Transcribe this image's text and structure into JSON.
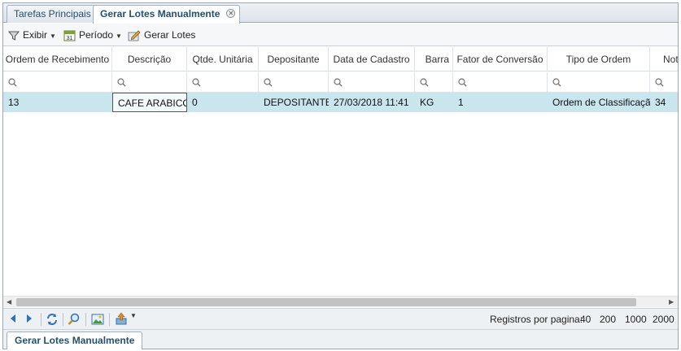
{
  "tabs": [
    {
      "label": "Tarefas Principais"
    },
    {
      "label": "Gerar Lotes Manualmente"
    }
  ],
  "toolbar": {
    "exibir_label": "Exibir",
    "periodo_label": "Período",
    "periodo_icon_day": "31",
    "gerar_label": "Gerar Lotes"
  },
  "grid": {
    "columns": [
      "Ordem de Recebimento",
      "Descrição",
      "Qtde. Unitária",
      "Depositante",
      "Data de Cadastro",
      "Barra",
      "Fator de Conversão",
      "Tipo de Ordem",
      "Nota"
    ],
    "rows": [
      [
        "13",
        "CAFE ARABICO",
        "0",
        "DEPOSITANTE",
        "27/03/2018 11:41",
        "KG",
        "1",
        "Ordem de Classificação",
        "34"
      ]
    ],
    "selected_row_color": "#c9e6ee"
  },
  "pager": {
    "label": "Registros por pagina:",
    "options": [
      "40",
      "200",
      "1000",
      "2000"
    ]
  },
  "bottom_tab": {
    "label": "Gerar Lotes Manualmente"
  }
}
